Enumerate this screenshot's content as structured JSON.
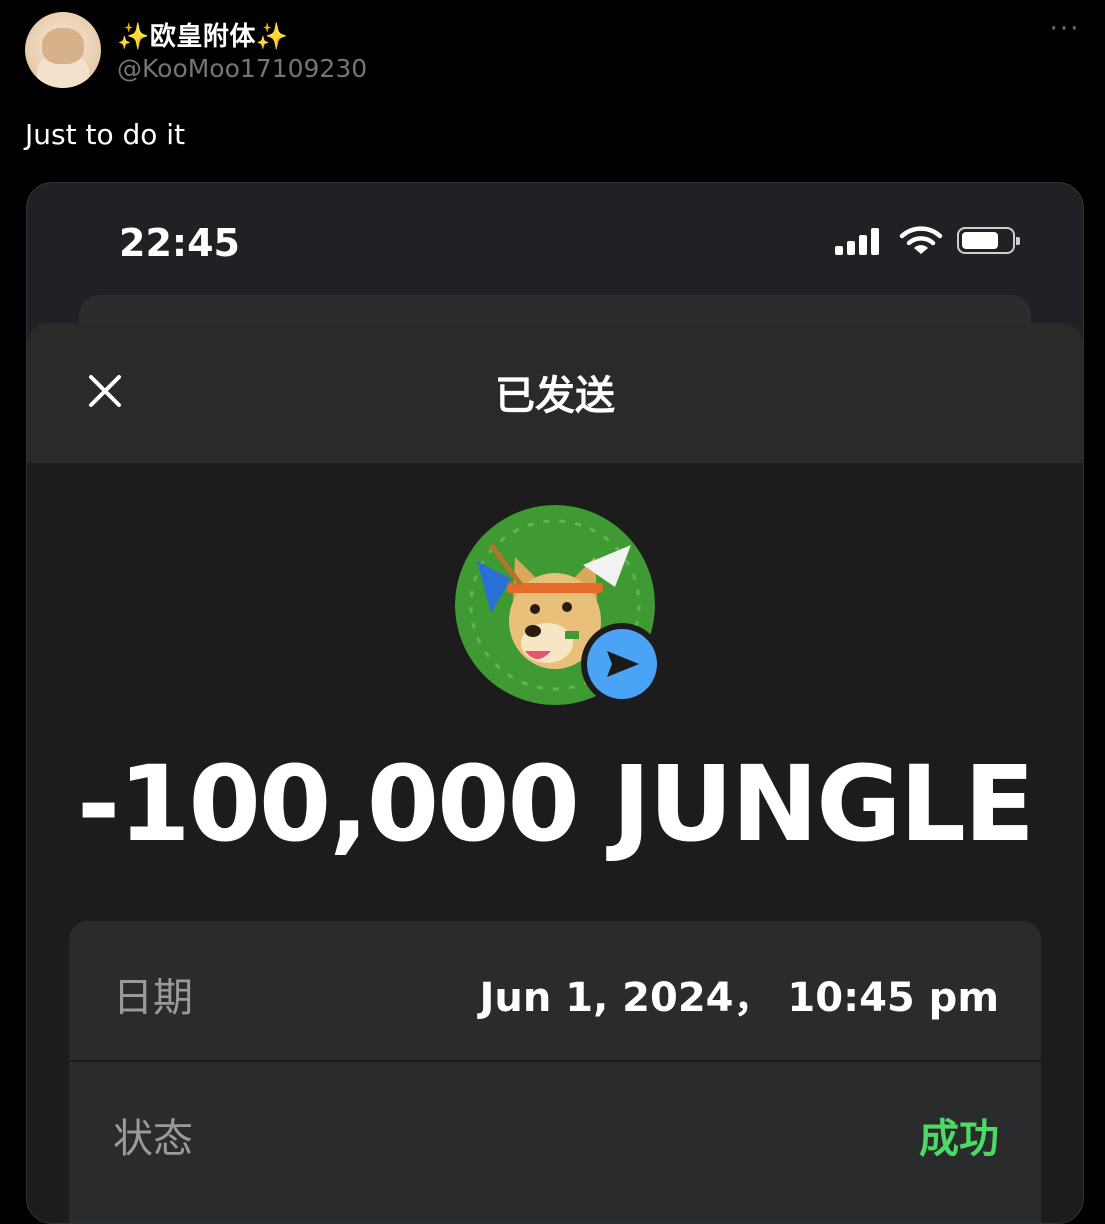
{
  "tweet": {
    "display_name_left_emoji": "✨",
    "display_name": "欧皇附体",
    "display_name_right_emoji": "✨",
    "handle": "@KooMoo17109230",
    "more_icon": "more-horizontal-icon",
    "text": "Just to do it"
  },
  "phone": {
    "status_bar": {
      "time": "22:45",
      "icons": [
        "signal-icon",
        "wifi-icon",
        "battery-icon"
      ]
    },
    "sheet": {
      "title": "已发送",
      "close_icon": "close-icon",
      "token_icon": "doge-token-icon",
      "send_badge_icon": "send-arrow-icon",
      "amount": "-100,000 JUNGLE",
      "details": [
        {
          "label": "日期",
          "value": "Jun 1, 2024，  10:45 pm"
        },
        {
          "label": "状态",
          "value": "成功"
        }
      ]
    }
  },
  "colors": {
    "background": "#000000",
    "card": "#1c1c1d",
    "header": "#2a2a2b",
    "detail_row": "#2a2b2d",
    "success": "#4cd964",
    "send_badge": "#4aa3f5",
    "token_green": "#3f9a34"
  }
}
